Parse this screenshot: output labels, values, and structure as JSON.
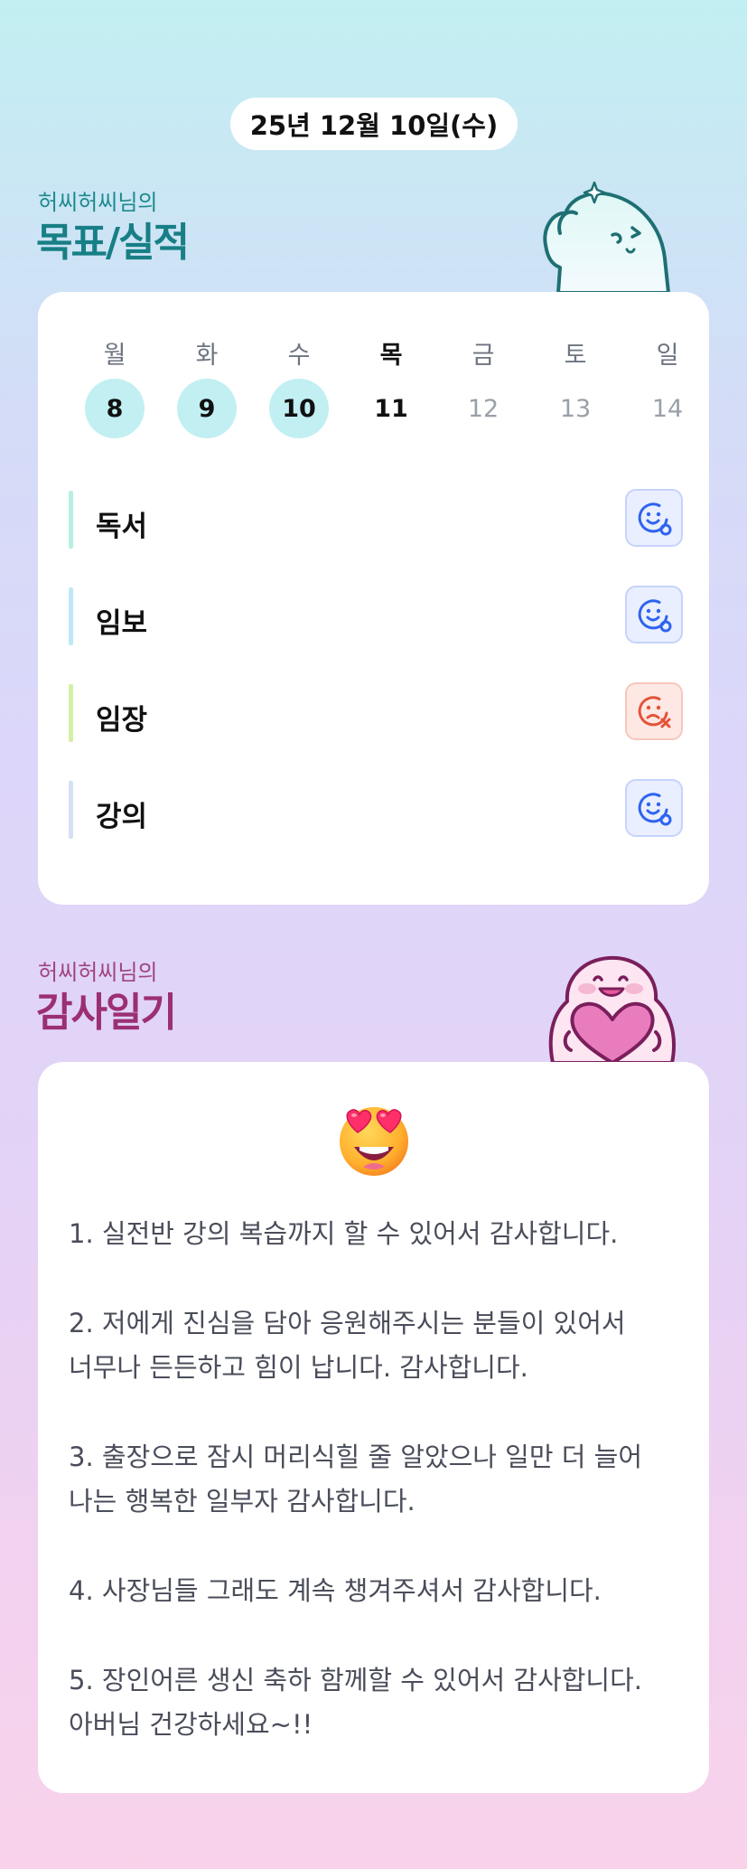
{
  "header": {
    "date": "25년 12월 10일(수)"
  },
  "goals_section": {
    "subtitle": "허씨허씨님의",
    "title": "목표/실적",
    "week": [
      {
        "label": "월",
        "num": "8",
        "state": "done"
      },
      {
        "label": "화",
        "num": "9",
        "state": "done"
      },
      {
        "label": "수",
        "num": "10",
        "state": "done"
      },
      {
        "label": "목",
        "num": "11",
        "state": "today"
      },
      {
        "label": "금",
        "num": "12",
        "state": "future"
      },
      {
        "label": "토",
        "num": "13",
        "state": "future"
      },
      {
        "label": "일",
        "num": "14",
        "state": "future"
      }
    ],
    "goals": [
      {
        "label": "독서",
        "bar_color": "#b8efe3",
        "status": "smile-success-icon"
      },
      {
        "label": "임보",
        "bar_color": "#bfe8f6",
        "status": "smile-success-icon"
      },
      {
        "label": "임장",
        "bar_color": "#d4f0a6",
        "status": "sad-fail-icon"
      },
      {
        "label": "강의",
        "bar_color": "#d4e0f4",
        "status": "smile-success-icon"
      }
    ]
  },
  "gratitude_section": {
    "subtitle": "허씨허씨님의",
    "title": "감사일기",
    "emoji": "heart-eyes-emoji",
    "entries": [
      "1. 실전반 강의 복습까지 할 수 있어서 감사합니다.",
      "2. 저에게 진심을 담아 응원해주시는 분들이 있어서\n너무나 든든하고 힘이 납니다. 감사합니다.",
      "3. 출장으로 잠시 머리식힐 줄 알았으나 일만 더 늘어\n나는 행복한 일부자 감사합니다.",
      "4. 사장님들 그래도 계속 챙겨주셔서 감사합니다.",
      "5. 장인어른 생신 축하 함께할 수 있어서 감사합니다.\n아버님 건강하세요~!!"
    ]
  },
  "colors": {
    "done_day": "#c2eff2",
    "goals_title": "#177f85",
    "gratitude_title": "#9c2f74",
    "success_icon": "#2f63f0",
    "fail_icon": "#e5533a"
  }
}
